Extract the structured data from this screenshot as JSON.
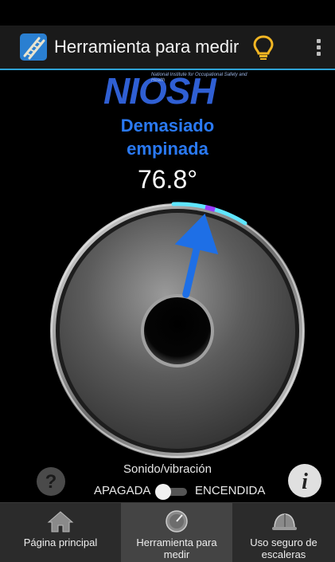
{
  "app": {
    "title": "Herramienta para medir"
  },
  "logo": {
    "wordmark": "NIOSH",
    "subtitle": "National Institute for Occupational Safety and Health"
  },
  "reading": {
    "status_line1": "Demasiado",
    "status_line2": "empinada",
    "angle": "76.8°"
  },
  "controls": {
    "sound_label": "Sonido/vibración",
    "off_label": "APAGADA",
    "on_label": "ENCENDIDA"
  },
  "nav": {
    "items": [
      {
        "label": "Página principal",
        "icon": "home-icon"
      },
      {
        "label": "Herramienta para medir",
        "icon": "gauge-icon"
      },
      {
        "label": "Uso seguro de escaleras",
        "icon": "hardhat-icon"
      }
    ]
  },
  "colors": {
    "accent": "#2fa3d6",
    "warning_text": "#2a79f2",
    "arrow": "#1e6fe6",
    "bulb": "#f2b623"
  }
}
